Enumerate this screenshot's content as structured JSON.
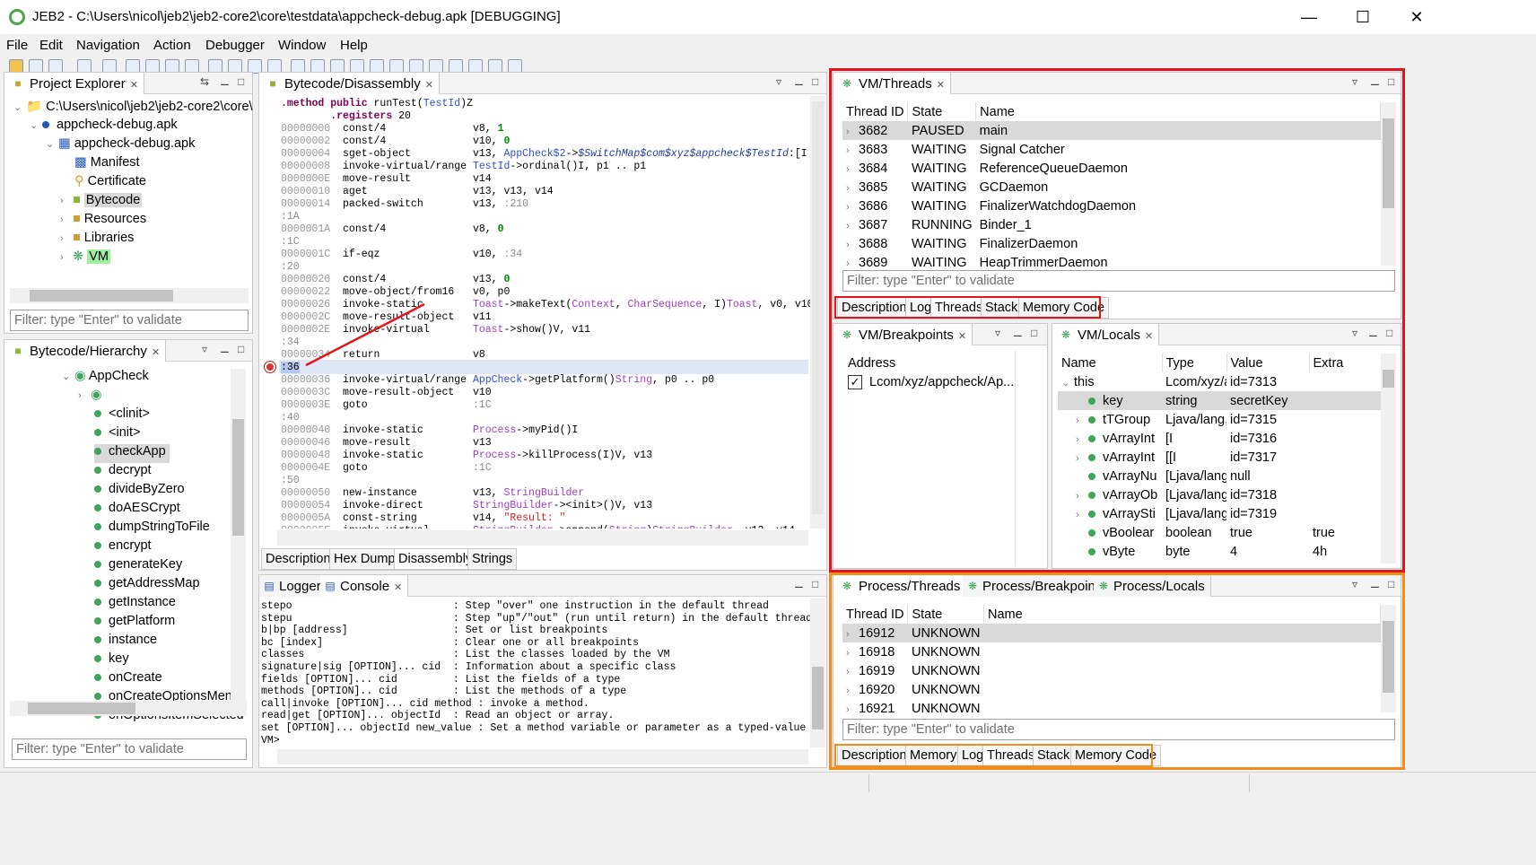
{
  "window": {
    "title": "JEB2 - C:\\Users\\nicol\\jeb2\\jeb2-core2\\core\\testdata\\appcheck-debug.apk [DEBUGGING]"
  },
  "menu": [
    "File",
    "Edit",
    "Navigation",
    "Action",
    "Debugger",
    "Window",
    "Help"
  ],
  "project_explorer": {
    "tab": "Project Explorer",
    "items": [
      "C:\\Users\\nicol\\jeb2\\jeb2-core2\\core\\",
      "appcheck-debug.apk",
      "appcheck-debug.apk",
      "Manifest",
      "Certificate",
      "Bytecode",
      "Resources",
      "Libraries",
      "VM"
    ],
    "filter_placeholder": "Filter: type \"Enter\" to validate"
  },
  "hierarchy": {
    "tab": "Bytecode/Hierarchy",
    "root": "AppCheck",
    "methods": [
      "<clinit>",
      "<init>",
      "checkApp",
      "decrypt",
      "divideByZero",
      "doAESCrypt",
      "dumpStringToFile",
      "encrypt",
      "generateKey",
      "getAddressMap",
      "getInstance",
      "getPlatform",
      "instance",
      "key",
      "onCreate",
      "onCreateOptionsMenu",
      "onOptionsItemSelected"
    ],
    "filter_placeholder": "Filter: type \"Enter\" to validate"
  },
  "disassembly": {
    "tab": "Bytecode/Disassembly",
    "bottom_tabs": [
      "Description",
      "Hex Dump",
      "Disassembly",
      "Strings"
    ]
  },
  "console": {
    "tabs": [
      "Logger",
      "Console"
    ],
    "lines": [
      "stepo                          : Step \"over\" one instruction in the default thread",
      "stepu                          : Step \"up\"/\"out\" (run until return) in the default thread",
      "b|bp [address]                 : Set or list breakpoints",
      "bc [index]                     : Clear one or all breakpoints",
      "classes                        : List the classes loaded by the VM",
      "signature|sig [OPTION]... cid  : Information about a specific class",
      "fields [OPTION]... cid         : List the fields of a type",
      "methods [OPTION].. cid         : List the methods of a type",
      "call|invoke [OPTION]... cid method : invoke a method.",
      "read|get [OPTION]... objectId  : Read an object or array.",
      "set [OPTION]... objectId new_value : Set a method variable or parameter as a typed-value",
      "VM>"
    ]
  },
  "vm_threads": {
    "tab": "VM/Threads",
    "columns": [
      "Thread ID",
      "State",
      "Name"
    ],
    "rows": [
      [
        "3682",
        "PAUSED",
        "main"
      ],
      [
        "3683",
        "WAITING",
        "Signal Catcher"
      ],
      [
        "3684",
        "WAITING",
        "ReferenceQueueDaemon"
      ],
      [
        "3685",
        "WAITING",
        "GCDaemon"
      ],
      [
        "3686",
        "WAITING",
        "FinalizerWatchdogDaemon"
      ],
      [
        "3687",
        "RUNNING",
        "Binder_1"
      ],
      [
        "3688",
        "WAITING",
        "FinalizerDaemon"
      ],
      [
        "3689",
        "WAITING",
        "HeapTrimmerDaemon"
      ]
    ],
    "filter_placeholder": "Filter: type \"Enter\" to validate",
    "bottom_tabs": [
      "Description",
      "Log",
      "Threads",
      "Stack",
      "Memory Code"
    ]
  },
  "vm_breakpoints": {
    "tab": "VM/Breakpoints",
    "column": "Address",
    "rows": [
      "Lcom/xyz/appcheck/Ap..."
    ]
  },
  "vm_locals": {
    "tab": "VM/Locals",
    "columns": [
      "Name",
      "Type",
      "Value",
      "Extra"
    ],
    "rows": [
      [
        "this",
        "Lcom/xyz/a",
        "id=7313",
        ""
      ],
      [
        "key",
        "string",
        "secretKey",
        ""
      ],
      [
        "tTGroup",
        "Ljava/lang,",
        "id=7315",
        ""
      ],
      [
        "vArrayInt",
        "[I",
        "id=7316",
        ""
      ],
      [
        "vArrayInt",
        "[[I",
        "id=7317",
        ""
      ],
      [
        "vArrayNu",
        "[Ljava/lang",
        "null",
        ""
      ],
      [
        "vArrayOb",
        "[Ljava/lang",
        "id=7318",
        ""
      ],
      [
        "vArraySti",
        "[Ljava/lang",
        "id=7319",
        ""
      ],
      [
        "vBoolear",
        "boolean",
        "true",
        "true"
      ],
      [
        "vByte",
        "byte",
        "4",
        "4h"
      ]
    ]
  },
  "process": {
    "tabs": [
      "Process/Threads",
      "Process/Breakpoints",
      "Process/Locals"
    ],
    "columns": [
      "Thread ID",
      "State",
      "Name"
    ],
    "rows": [
      [
        "16912",
        "UNKNOWN",
        ""
      ],
      [
        "16918",
        "UNKNOWN",
        ""
      ],
      [
        "16919",
        "UNKNOWN",
        ""
      ],
      [
        "16920",
        "UNKNOWN",
        ""
      ],
      [
        "16921",
        "UNKNOWN",
        ""
      ]
    ],
    "filter_placeholder": "Filter: type \"Enter\" to validate",
    "bottom_tabs": [
      "Description",
      "Memory",
      "Log",
      "Threads",
      "Stack",
      "Memory Code"
    ]
  },
  "colors": {
    "highlight_red": "#e3151a",
    "highlight_orange": "#f28c1c",
    "selection": "#d9d9d9"
  }
}
